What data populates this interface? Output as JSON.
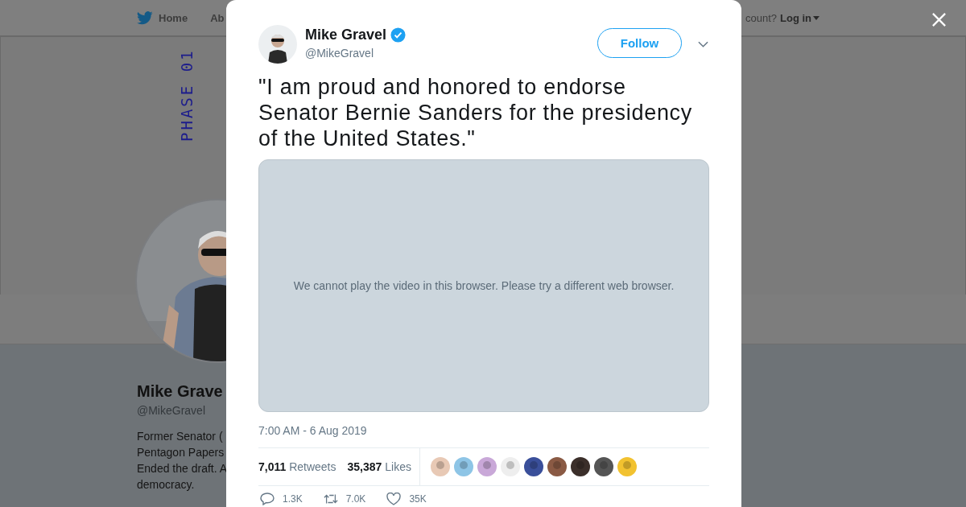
{
  "top_nav": {
    "items": [
      {
        "kind": "home",
        "label": "Home"
      },
      {
        "kind": "link",
        "label": "Ab"
      }
    ],
    "account_prompt": "count?",
    "login": "Log in"
  },
  "banner": {
    "text": "PHASE 01"
  },
  "profile": {
    "name": "Mike Grave",
    "handle": "@MikeGravel",
    "bio_lines": [
      "Former Senator (",
      "Pentagon Papers",
      "Ended the draft. A",
      "democracy."
    ]
  },
  "tweet": {
    "author": "Mike Gravel",
    "verified": true,
    "handle": "@MikeGravel",
    "follow": "Follow",
    "text": "\"I am proud and honored to endorse Senator Bernie Sanders for the presidency of the United States.\"",
    "video_message": "We cannot play the video in this browser. Please try a different web browser.",
    "timestamp": "7:00 AM - 6 Aug 2019",
    "stats": [
      {
        "count": "7,011",
        "label": "Retweets"
      },
      {
        "count": "35,387",
        "label": "Likes"
      }
    ],
    "actions": [
      {
        "kind": "reply",
        "count": "1.3K"
      },
      {
        "kind": "retweet",
        "count": "7.0K"
      },
      {
        "kind": "like",
        "count": "35K"
      }
    ]
  }
}
